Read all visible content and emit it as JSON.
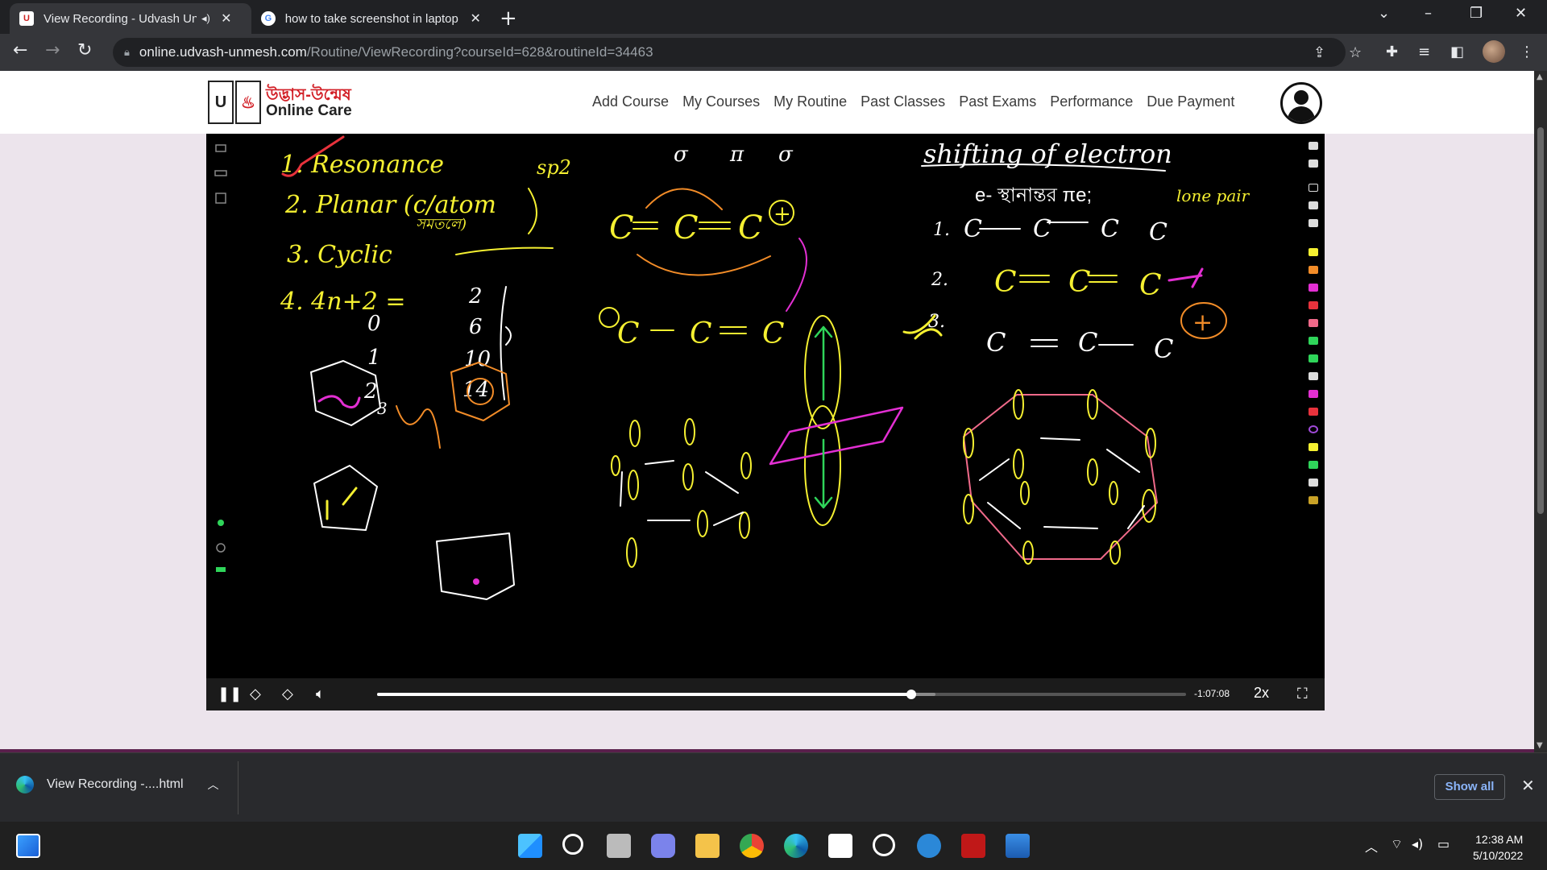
{
  "browser": {
    "tabs": [
      {
        "title": "View Recording - Udvash Un",
        "favicon": "udvash-icon",
        "audio": true
      },
      {
        "title": "how to take screenshot in laptop",
        "favicon": "google-icon",
        "audio": false
      }
    ],
    "url_host": "online.udvash-unmesh.com",
    "url_path": "/Routine/ViewRecording?courseId=628&routineId=34463"
  },
  "site": {
    "logo_bn": "উদ্ভাস-উন্মেষ",
    "logo_en": "Online Care",
    "nav": [
      "Add Course",
      "My Courses",
      "My Routine",
      "Past Classes",
      "Past Exams",
      "Performance",
      "Due Payment"
    ]
  },
  "board": {
    "list": [
      "1. Resonance",
      "2. Planar (c/atom",
      "সমতলে)",
      "3. Cyclic",
      "4. 4n+2 ="
    ],
    "n_values": [
      "0",
      "1",
      "2",
      "3"
    ],
    "pi_counts": [
      "2",
      "6",
      "10",
      "14"
    ],
    "sp2": "sp2",
    "top_labels": [
      "σ",
      "π",
      "σ"
    ],
    "heading": "shifting of electron",
    "subhead": "e- স্থানান্তর πe;",
    "lone_pair": "lone pair",
    "case_nums": [
      "1.",
      "2.",
      "3."
    ],
    "plus_sign": "+",
    "atom": "C"
  },
  "player": {
    "time_remaining": "-1:07:08",
    "speed": "2x",
    "progress": 0.66,
    "buffered": 0.69
  },
  "downloads": {
    "item": "View Recording -....html",
    "show_all": "Show all"
  },
  "taskbar": {
    "time": "12:38 AM",
    "date": "5/10/2022"
  },
  "colors": {
    "ink_yellow": "#f5f031",
    "ink_white": "#ffffff",
    "ink_orange": "#f28c28",
    "ink_magenta": "#e32fd3",
    "ink_green": "#2fd55a",
    "ink_pink": "#f06a8a",
    "ink_red": "#e8323c"
  }
}
